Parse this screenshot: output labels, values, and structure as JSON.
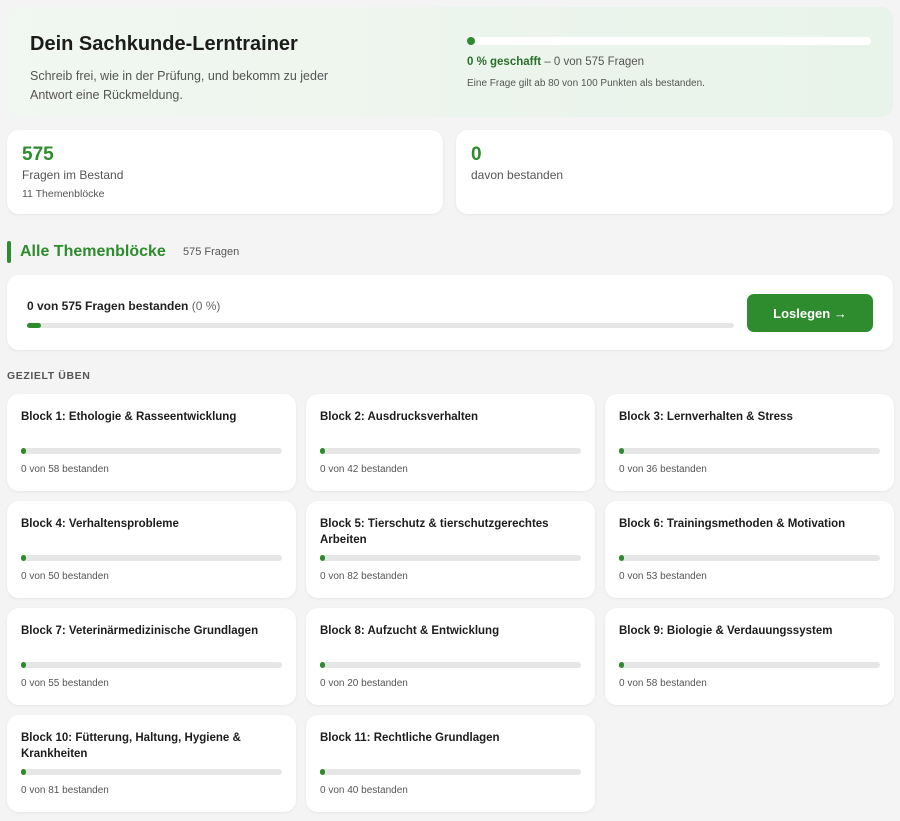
{
  "hero": {
    "title": "Dein Sachkunde-Lerntrainer",
    "subtitle": "Schreib frei, wie in der Prüfung, und bekomm zu jeder Antwort eine Rückmeldung.",
    "progress_percent": 0,
    "progress_strong": "0 % geschafft",
    "progress_rest": " – 0 von 575 Fragen",
    "note": "Eine Frage gilt ab 80 von 100 Punkten als bestanden."
  },
  "stats": [
    {
      "value": "575",
      "label": "Fragen im Bestand",
      "sub": "11 Themenblöcke"
    },
    {
      "value": "0",
      "label": "davon bestanden",
      "sub": ""
    }
  ],
  "section": {
    "title": "Alle Themenblöcke",
    "count": "575 Fragen"
  },
  "overall": {
    "text_strong": "0 von 575 Fragen bestanden",
    "text_pct": " (0 %)",
    "progress_percent": 0,
    "button_label": "Loslegen →"
  },
  "practice": {
    "label": "GEZIELT ÜBEN",
    "blocks": [
      {
        "title": "Block 1: Ethologie & Rasseentwicklung",
        "count": "0 von 58 bestanden",
        "progress_percent": 0
      },
      {
        "title": "Block 2: Ausdrucksverhalten",
        "count": "0 von 42 bestanden",
        "progress_percent": 0
      },
      {
        "title": "Block 3: Lernverhalten & Stress",
        "count": "0 von 36 bestanden",
        "progress_percent": 0
      },
      {
        "title": "Block 4: Verhaltensprobleme",
        "count": "0 von 50 bestanden",
        "progress_percent": 0
      },
      {
        "title": "Block 5: Tierschutz & tierschutzgerechtes Arbeiten",
        "count": "0 von 82 bestanden",
        "progress_percent": 0
      },
      {
        "title": "Block 6: Trainingsmethoden & Motivation",
        "count": "0 von 53 bestanden",
        "progress_percent": 0
      },
      {
        "title": "Block 7: Veterinärmedizinische Grundlagen",
        "count": "0 von 55 bestanden",
        "progress_percent": 0
      },
      {
        "title": "Block 8: Aufzucht & Entwicklung",
        "count": "0 von 20 bestanden",
        "progress_percent": 0
      },
      {
        "title": "Block 9: Biologie & Verdauungssystem",
        "count": "0 von 58 bestanden",
        "progress_percent": 0
      },
      {
        "title": "Block 10: Fütterung, Haltung, Hygiene & Krankheiten",
        "count": "0 von 81 bestanden",
        "progress_percent": 0
      },
      {
        "title": "Block 11: Rechtliche Grundlagen",
        "count": "0 von 40 bestanden",
        "progress_percent": 0
      }
    ]
  },
  "colors": {
    "accent": "#2e8b2e",
    "track": "#e6e6e6",
    "hero_bg": "#eaf4eb"
  }
}
